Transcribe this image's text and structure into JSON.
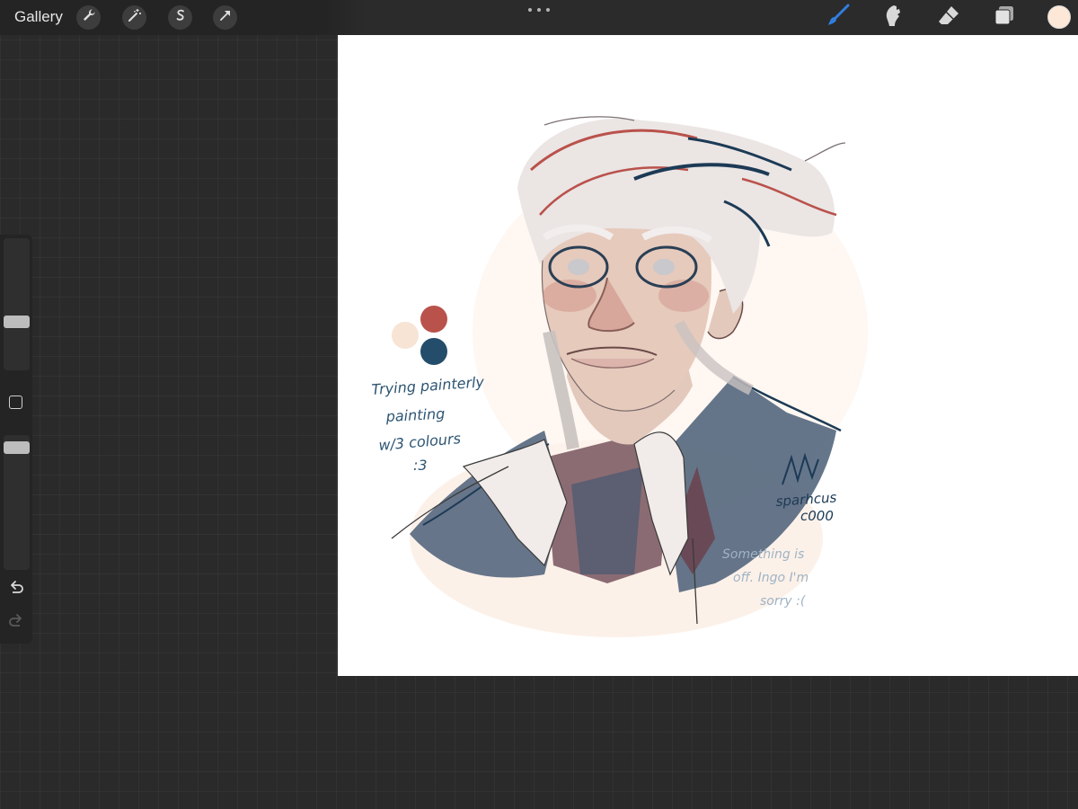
{
  "toolbar": {
    "gallery_label": "Gallery",
    "left_tools": [
      {
        "icon": "wrench-icon",
        "name": "Actions"
      },
      {
        "icon": "magic-wand-icon",
        "name": "Adjustments"
      },
      {
        "icon": "selection-s-icon",
        "name": "Selection"
      },
      {
        "icon": "arrow-cursor-icon",
        "name": "Transform"
      }
    ],
    "right_tools": [
      {
        "icon": "brush-icon",
        "name": "Paint",
        "active": true
      },
      {
        "icon": "smudge-icon",
        "name": "Smudge",
        "active": false
      },
      {
        "icon": "eraser-icon",
        "name": "Erase",
        "active": false
      },
      {
        "icon": "layers-icon",
        "name": "Layers",
        "active": false
      }
    ],
    "current_color": "#fde8d8",
    "active_color": "#2f7fe0"
  },
  "sidebar": {
    "brush_size_level": 0.35,
    "opacity_level": 0.95,
    "undo_icon": "undo-icon",
    "redo_icon": "redo-icon"
  },
  "artwork": {
    "palette": [
      "#f7e4d5",
      "#b9524b",
      "#234d6b"
    ],
    "note_lines": [
      "Trying painterly",
      "painting",
      "w/3 colours",
      ":3"
    ],
    "signature_lines": [
      "sparhcus",
      "c000"
    ],
    "footer_lines": [
      "Something is",
      "off. Ingo I'm",
      "sorry :("
    ]
  }
}
